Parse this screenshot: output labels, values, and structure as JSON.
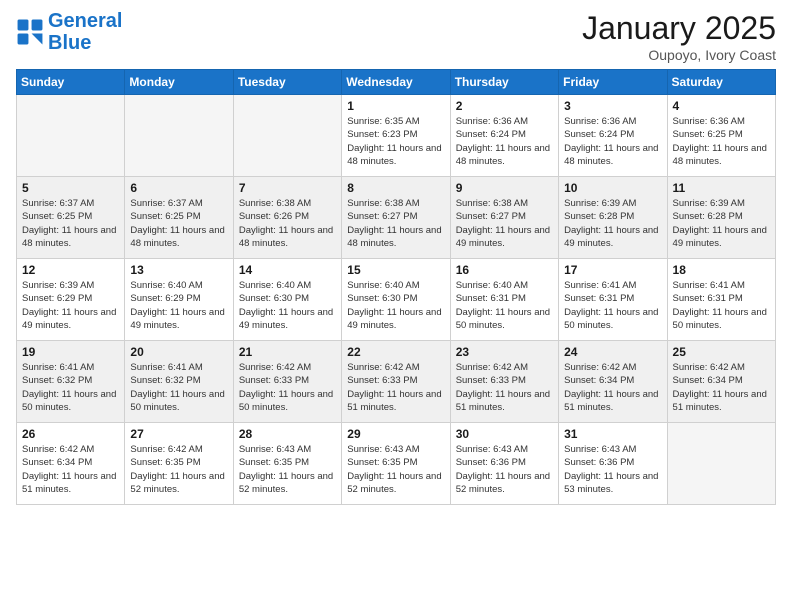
{
  "header": {
    "logo_general": "General",
    "logo_blue": "Blue",
    "month_title": "January 2025",
    "location": "Oupoyo, Ivory Coast"
  },
  "weekdays": [
    "Sunday",
    "Monday",
    "Tuesday",
    "Wednesday",
    "Thursday",
    "Friday",
    "Saturday"
  ],
  "weeks": [
    [
      {
        "day": "",
        "info": ""
      },
      {
        "day": "",
        "info": ""
      },
      {
        "day": "",
        "info": ""
      },
      {
        "day": "1",
        "info": "Sunrise: 6:35 AM\nSunset: 6:23 PM\nDaylight: 11 hours\nand 48 minutes."
      },
      {
        "day": "2",
        "info": "Sunrise: 6:36 AM\nSunset: 6:24 PM\nDaylight: 11 hours\nand 48 minutes."
      },
      {
        "day": "3",
        "info": "Sunrise: 6:36 AM\nSunset: 6:24 PM\nDaylight: 11 hours\nand 48 minutes."
      },
      {
        "day": "4",
        "info": "Sunrise: 6:36 AM\nSunset: 6:25 PM\nDaylight: 11 hours\nand 48 minutes."
      }
    ],
    [
      {
        "day": "5",
        "info": "Sunrise: 6:37 AM\nSunset: 6:25 PM\nDaylight: 11 hours\nand 48 minutes."
      },
      {
        "day": "6",
        "info": "Sunrise: 6:37 AM\nSunset: 6:25 PM\nDaylight: 11 hours\nand 48 minutes."
      },
      {
        "day": "7",
        "info": "Sunrise: 6:38 AM\nSunset: 6:26 PM\nDaylight: 11 hours\nand 48 minutes."
      },
      {
        "day": "8",
        "info": "Sunrise: 6:38 AM\nSunset: 6:27 PM\nDaylight: 11 hours\nand 48 minutes."
      },
      {
        "day": "9",
        "info": "Sunrise: 6:38 AM\nSunset: 6:27 PM\nDaylight: 11 hours\nand 49 minutes."
      },
      {
        "day": "10",
        "info": "Sunrise: 6:39 AM\nSunset: 6:28 PM\nDaylight: 11 hours\nand 49 minutes."
      },
      {
        "day": "11",
        "info": "Sunrise: 6:39 AM\nSunset: 6:28 PM\nDaylight: 11 hours\nand 49 minutes."
      }
    ],
    [
      {
        "day": "12",
        "info": "Sunrise: 6:39 AM\nSunset: 6:29 PM\nDaylight: 11 hours\nand 49 minutes."
      },
      {
        "day": "13",
        "info": "Sunrise: 6:40 AM\nSunset: 6:29 PM\nDaylight: 11 hours\nand 49 minutes."
      },
      {
        "day": "14",
        "info": "Sunrise: 6:40 AM\nSunset: 6:30 PM\nDaylight: 11 hours\nand 49 minutes."
      },
      {
        "day": "15",
        "info": "Sunrise: 6:40 AM\nSunset: 6:30 PM\nDaylight: 11 hours\nand 49 minutes."
      },
      {
        "day": "16",
        "info": "Sunrise: 6:40 AM\nSunset: 6:31 PM\nDaylight: 11 hours\nand 50 minutes."
      },
      {
        "day": "17",
        "info": "Sunrise: 6:41 AM\nSunset: 6:31 PM\nDaylight: 11 hours\nand 50 minutes."
      },
      {
        "day": "18",
        "info": "Sunrise: 6:41 AM\nSunset: 6:31 PM\nDaylight: 11 hours\nand 50 minutes."
      }
    ],
    [
      {
        "day": "19",
        "info": "Sunrise: 6:41 AM\nSunset: 6:32 PM\nDaylight: 11 hours\nand 50 minutes."
      },
      {
        "day": "20",
        "info": "Sunrise: 6:41 AM\nSunset: 6:32 PM\nDaylight: 11 hours\nand 50 minutes."
      },
      {
        "day": "21",
        "info": "Sunrise: 6:42 AM\nSunset: 6:33 PM\nDaylight: 11 hours\nand 50 minutes."
      },
      {
        "day": "22",
        "info": "Sunrise: 6:42 AM\nSunset: 6:33 PM\nDaylight: 11 hours\nand 51 minutes."
      },
      {
        "day": "23",
        "info": "Sunrise: 6:42 AM\nSunset: 6:33 PM\nDaylight: 11 hours\nand 51 minutes."
      },
      {
        "day": "24",
        "info": "Sunrise: 6:42 AM\nSunset: 6:34 PM\nDaylight: 11 hours\nand 51 minutes."
      },
      {
        "day": "25",
        "info": "Sunrise: 6:42 AM\nSunset: 6:34 PM\nDaylight: 11 hours\nand 51 minutes."
      }
    ],
    [
      {
        "day": "26",
        "info": "Sunrise: 6:42 AM\nSunset: 6:34 PM\nDaylight: 11 hours\nand 51 minutes."
      },
      {
        "day": "27",
        "info": "Sunrise: 6:42 AM\nSunset: 6:35 PM\nDaylight: 11 hours\nand 52 minutes."
      },
      {
        "day": "28",
        "info": "Sunrise: 6:43 AM\nSunset: 6:35 PM\nDaylight: 11 hours\nand 52 minutes."
      },
      {
        "day": "29",
        "info": "Sunrise: 6:43 AM\nSunset: 6:35 PM\nDaylight: 11 hours\nand 52 minutes."
      },
      {
        "day": "30",
        "info": "Sunrise: 6:43 AM\nSunset: 6:36 PM\nDaylight: 11 hours\nand 52 minutes."
      },
      {
        "day": "31",
        "info": "Sunrise: 6:43 AM\nSunset: 6:36 PM\nDaylight: 11 hours\nand 53 minutes."
      },
      {
        "day": "",
        "info": ""
      }
    ]
  ]
}
